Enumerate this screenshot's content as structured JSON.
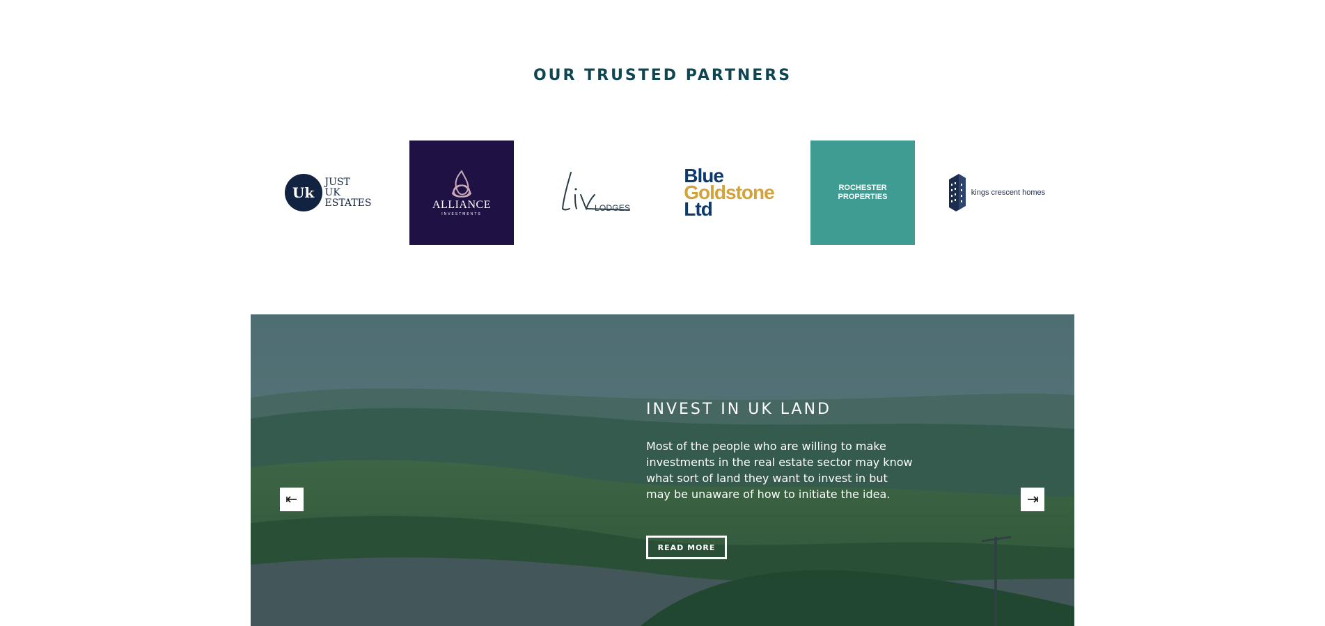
{
  "partners": {
    "title": "OUR TRUSTED PARTNERS",
    "logos": [
      {
        "name": "just-uk-estates",
        "lines": [
          "JUST",
          "UK",
          "ESTATES"
        ],
        "mark": "Uk",
        "color": "#112340"
      },
      {
        "name": "alliance-investments",
        "name_text": "ALLIANCE",
        "sub_text": "INVESTMENTS",
        "background": "#1f1144"
      },
      {
        "name": "liv-lodges",
        "script_text": "Liv",
        "sub_text": "LODGES"
      },
      {
        "name": "blue-goldstone-ltd",
        "lines": [
          "Blue",
          "Goldstone",
          "Ltd"
        ],
        "colors": [
          "#0b3a6b",
          "#d4a23a"
        ]
      },
      {
        "name": "rochester-properties",
        "lines": [
          "ROCHESTER",
          "PROPERTIES"
        ],
        "background": "#3e9c93"
      },
      {
        "name": "kings-crescent-homes",
        "text": "kings crescent homes",
        "color": "#1c2c4c"
      }
    ]
  },
  "hero": {
    "title": "INVEST IN UK LAND",
    "text": "Most of the people who are willing to make investments in the real estate sector may know what sort of land they want to invest in but may be unaware of how to initiate the idea.",
    "button_label": "READ MORE",
    "prev_icon": "arrow-left-icon",
    "next_icon": "arrow-right-icon"
  },
  "colors": {
    "title": "#0e4551",
    "overlay": "#143741",
    "button_border": "#ffffff"
  }
}
